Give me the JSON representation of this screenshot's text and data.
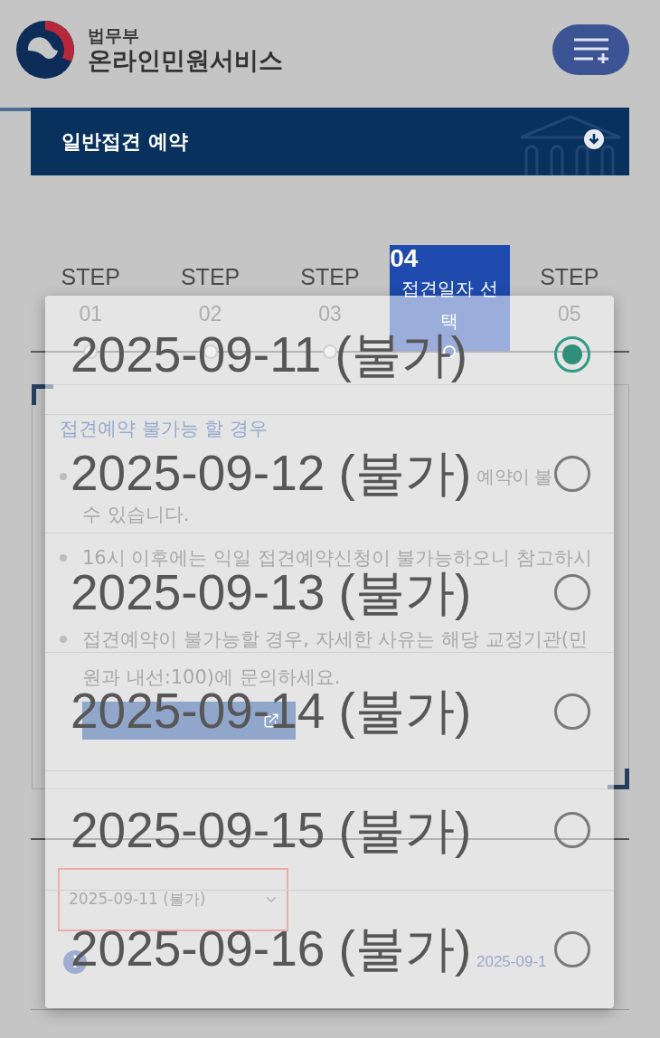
{
  "header": {
    "ministry": "법무부",
    "service": "온라인민원서비스"
  },
  "banner": {
    "title": "일반접견 예약"
  },
  "steps": [
    {
      "label": "STEP",
      "number": "01",
      "selected": false
    },
    {
      "label": "STEP",
      "number": "02",
      "selected": false
    },
    {
      "label": "STEP",
      "number": "03",
      "selected": false
    },
    {
      "label": "접견일자 선택",
      "number": "04",
      "selected": true
    },
    {
      "label": "STEP",
      "number": "05",
      "selected": false
    }
  ],
  "notice": {
    "title": "접견예약 불가능 할 경우",
    "items": [
      {
        "kind": "fragments",
        "lines": [
          {
            "kind": "tail",
            "text": "예약이 불"
          },
          {
            "kind": "head",
            "text": "수 있습니다."
          }
        ]
      },
      {
        "kind": "fragments",
        "lines": [
          {
            "kind": "head",
            "text": "16시 이후에는 익일 접견예약신청이 불가능하오니 참고하시"
          }
        ]
      },
      {
        "kind": "text",
        "text": "접견예약이 불가능할 경우, 자세한 사유는 해당 교정기관(민원과 내선:100)에 문의하세요."
      }
    ]
  },
  "date_select": {
    "value": "2025-09-11 (불가)"
  },
  "period_note": "2025-09-1",
  "date_dialog": {
    "options": [
      {
        "label": "2025-09-11 (불가)",
        "selected": true
      },
      {
        "label": "2025-09-12 (불가)",
        "selected": false
      },
      {
        "label": "2025-09-13 (불가)",
        "selected": false
      },
      {
        "label": "2025-09-14 (불가)",
        "selected": false
      },
      {
        "label": "2025-09-15 (불가)",
        "selected": false
      },
      {
        "label": "2025-09-16 (불가)",
        "selected": false
      }
    ]
  }
}
